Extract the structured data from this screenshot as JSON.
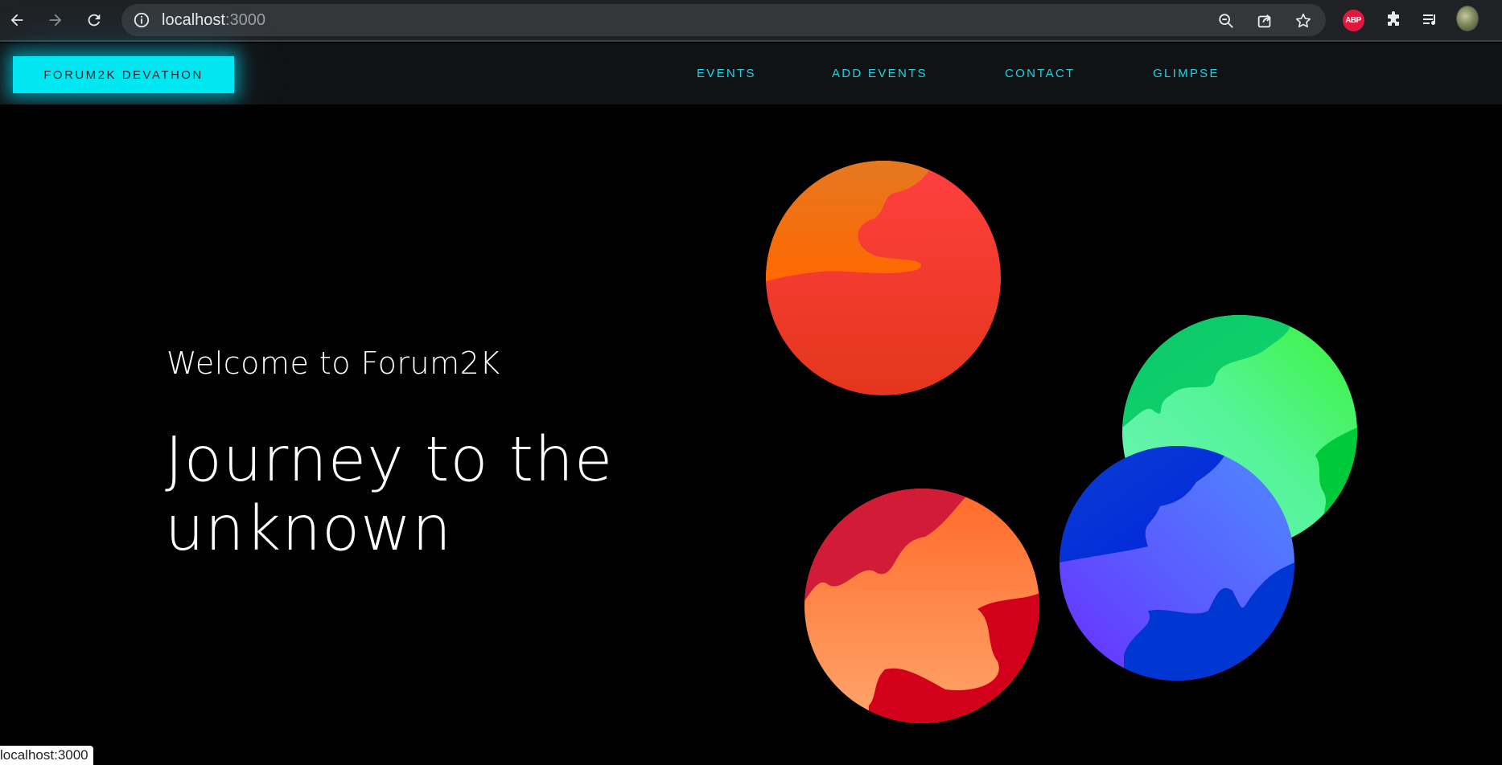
{
  "browser": {
    "url_host": "localhost",
    "url_port": ":3000",
    "status_url": "localhost:3000",
    "extensions": [
      "adblock-plus-icon",
      "extensions-puzzle-icon",
      "media-playlist-icon",
      "profile-avatar"
    ],
    "abp_label": "ABP"
  },
  "site": {
    "brand": "FORUM2K DEVATHON",
    "nav": [
      "EVENTS",
      "ADD EVENTS",
      "CONTACT",
      "GLIMPSE"
    ],
    "accent": "#00e7f2"
  },
  "hero": {
    "welcome": "Welcome to Forum2K",
    "headline": "Journey to the unknown"
  },
  "planets": [
    {
      "name": "orange-planet",
      "colors": [
        "#ff3d3d",
        "#e8401a",
        "#ff6a00",
        "#e87a20"
      ]
    },
    {
      "name": "green-planet",
      "colors": [
        "#10d66a",
        "#3af23a",
        "#5ef5a8",
        "#00c83c"
      ]
    },
    {
      "name": "blue-planet",
      "colors": [
        "#0a3fd0",
        "#4d8bff",
        "#6a2cff",
        "#0034d6"
      ]
    },
    {
      "name": "red-planet",
      "colors": [
        "#d31a34",
        "#ff6a2a",
        "#ffa36b",
        "#d3001c"
      ]
    }
  ]
}
